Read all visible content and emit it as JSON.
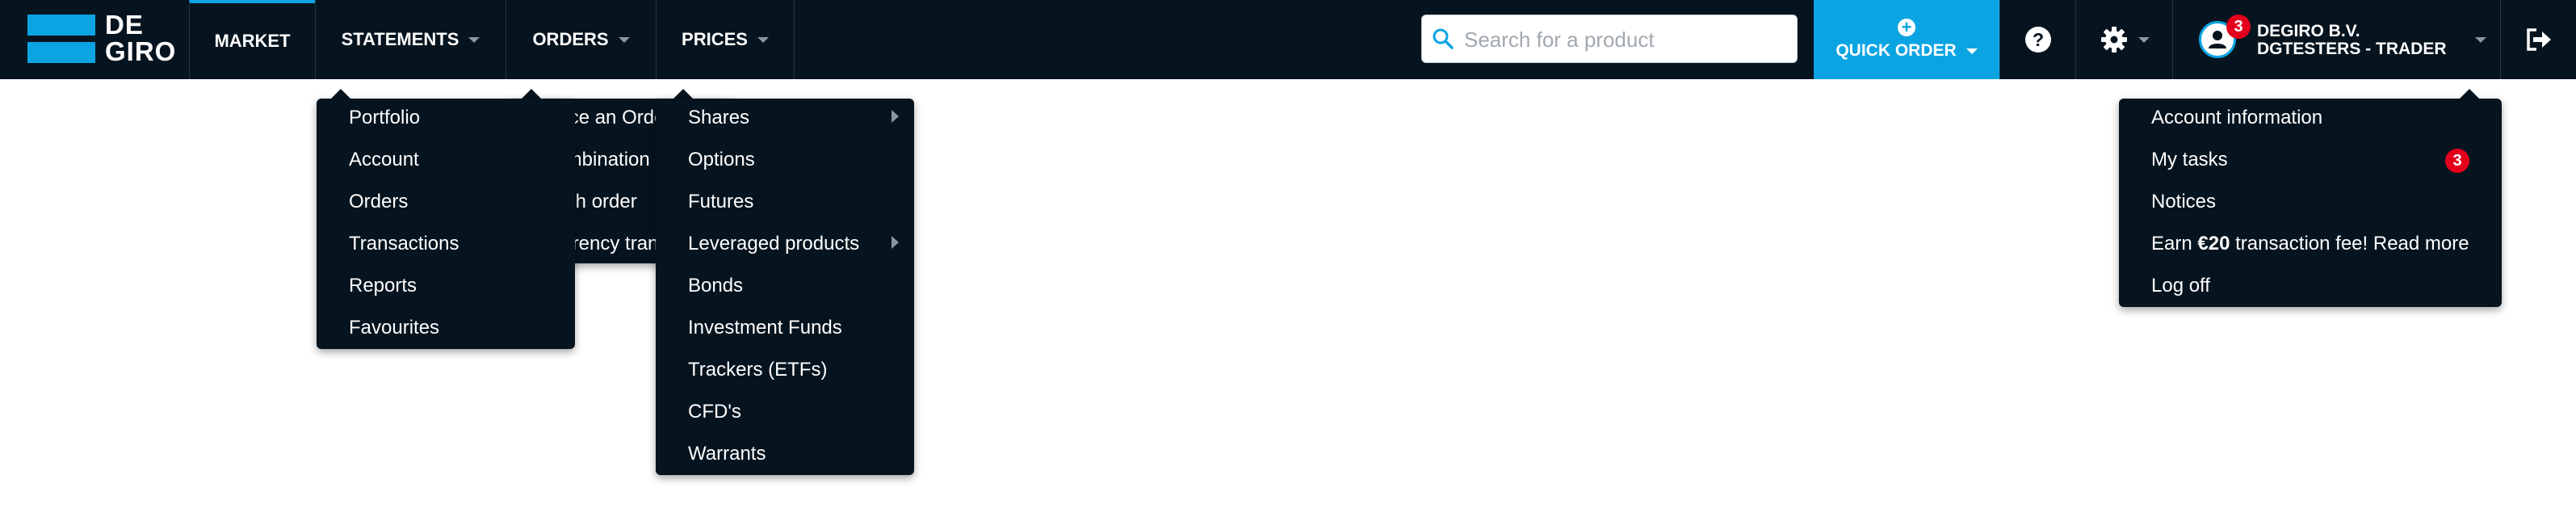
{
  "brand": {
    "logo_line1": "DE",
    "logo_line2": "GIRO",
    "accent_color": "#0ba4e3",
    "bar_color": "#06141f"
  },
  "nav": [
    {
      "label": "MARKET"
    },
    {
      "label": "STATEMENTS"
    },
    {
      "label": "ORDERS"
    },
    {
      "label": "PRICES"
    }
  ],
  "search": {
    "placeholder": "Search for a product",
    "icon": "search-icon"
  },
  "quick_order": {
    "label": "QUICK ORDER",
    "icon": "plus-circle-icon"
  },
  "help": {
    "icon": "question-circle-icon"
  },
  "settings": {
    "icon": "gear-icon"
  },
  "user": {
    "badge_count": "3",
    "line1": "DEGIRO B.V.",
    "line2": "DGTESTERS - TRADER",
    "icon": "user-icon"
  },
  "logout": {
    "icon": "logout-icon"
  },
  "statements_menu": [
    "Portfolio",
    "Account",
    "Orders",
    "Transactions",
    "Reports",
    "Favourites"
  ],
  "orders_menu": [
    "Place an Order",
    "Combination order",
    "Cash order",
    "Currency transfer"
  ],
  "prices_menu": [
    {
      "label": "Shares",
      "submenu": true
    },
    {
      "label": "Options",
      "submenu": false
    },
    {
      "label": "Futures",
      "submenu": false
    },
    {
      "label": "Leveraged products",
      "submenu": true
    },
    {
      "label": "Bonds",
      "submenu": false
    },
    {
      "label": "Investment Funds",
      "submenu": false
    },
    {
      "label": "Trackers (ETFs)",
      "submenu": false
    },
    {
      "label": "CFD's",
      "submenu": false
    },
    {
      "label": "Warrants",
      "submenu": false
    }
  ],
  "account_menu": {
    "account_information": "Account information",
    "my_tasks": "My tasks",
    "my_tasks_badge": "3",
    "notices": "Notices",
    "earn_prefix": "Earn ",
    "earn_amount": "€20",
    "earn_suffix": " transaction fee! Read more",
    "log_off": "Log off"
  }
}
